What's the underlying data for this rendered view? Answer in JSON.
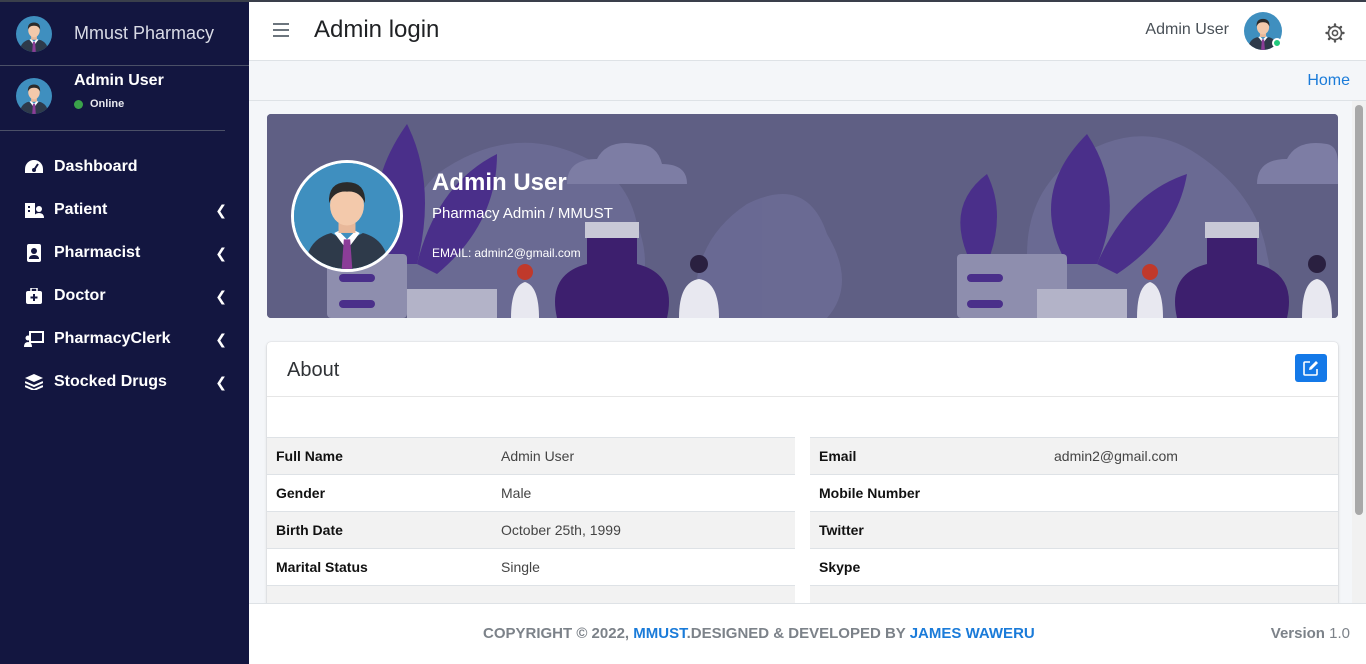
{
  "sidebar": {
    "brand": "Mmust Pharmacy",
    "user_name": "Admin User",
    "status": "Online",
    "items": [
      {
        "label": "Dashboard",
        "icon": "tachometer-icon",
        "has_children": false
      },
      {
        "label": "Patient",
        "icon": "hospital-user-icon",
        "has_children": true
      },
      {
        "label": "Pharmacist",
        "icon": "id-badge-icon",
        "has_children": true
      },
      {
        "label": "Doctor",
        "icon": "medkit-icon",
        "has_children": true
      },
      {
        "label": "PharmacyClerk",
        "icon": "chalkboard-user-icon",
        "has_children": true
      },
      {
        "label": "Stocked Drugs",
        "icon": "layers-icon",
        "has_children": true
      }
    ]
  },
  "header": {
    "title": "Admin login",
    "user_name": "Admin User"
  },
  "breadcrumb": {
    "home": "Home"
  },
  "profile": {
    "name": "Admin User",
    "role": "Pharmacy Admin / MMUST",
    "email_label": "EMAIL:",
    "email": "admin2@gmail.com"
  },
  "about": {
    "title": "About",
    "left": [
      {
        "label": "Full Name",
        "value": "Admin User"
      },
      {
        "label": "Gender",
        "value": "Male"
      },
      {
        "label": "Birth Date",
        "value": "October 25th, 1999"
      },
      {
        "label": "Marital Status",
        "value": "Single"
      }
    ],
    "right": [
      {
        "label": "Email",
        "value": "admin2@gmail.com"
      },
      {
        "label": "Mobile Number",
        "value": ""
      },
      {
        "label": "Twitter",
        "value": ""
      },
      {
        "label": "Skype",
        "value": ""
      }
    ]
  },
  "footer": {
    "copyright_prefix": "COPYRIGHT © 2022,",
    "org": "MMUST",
    "designed": ".DESIGNED & DEVELOPED BY",
    "author": "JAMES WAWERU",
    "version_label": "Version",
    "version": "1.0"
  },
  "colors": {
    "sidebar_bg": "#131640",
    "accent": "#1a7bd9",
    "online": "#3aa24a",
    "hero_bg": "#5f5f84"
  }
}
